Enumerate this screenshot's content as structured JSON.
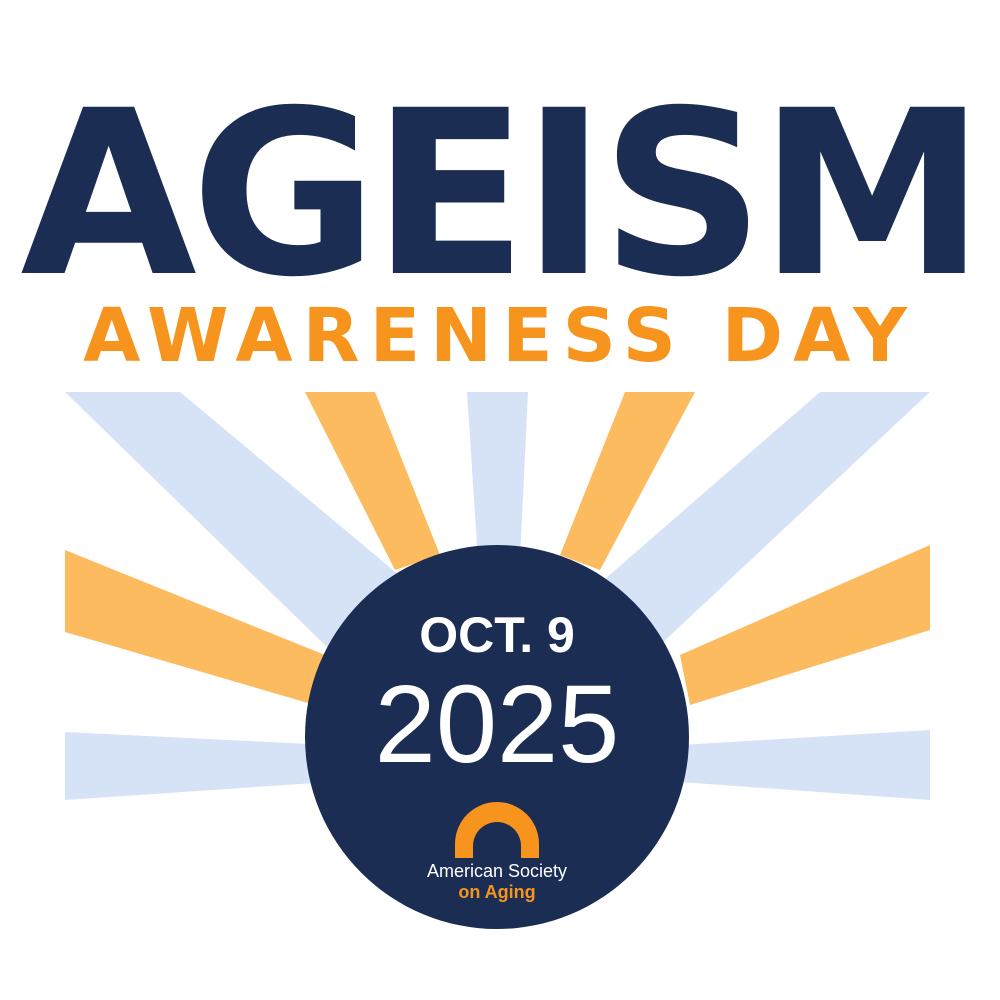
{
  "headline": "AGEISM",
  "subline": "AWARENESS DAY",
  "event": {
    "date": "OCT. 9",
    "year": "2025"
  },
  "organization": {
    "line1": "American Society",
    "line2": "on Aging",
    "logo_icon": "arch-logo-icon"
  },
  "colors": {
    "navy": "#1b2d52",
    "orange": "#f7941d",
    "light_orange": "#fdbb5f",
    "light_blue": "#d6e3f7",
    "white": "#ffffff"
  }
}
